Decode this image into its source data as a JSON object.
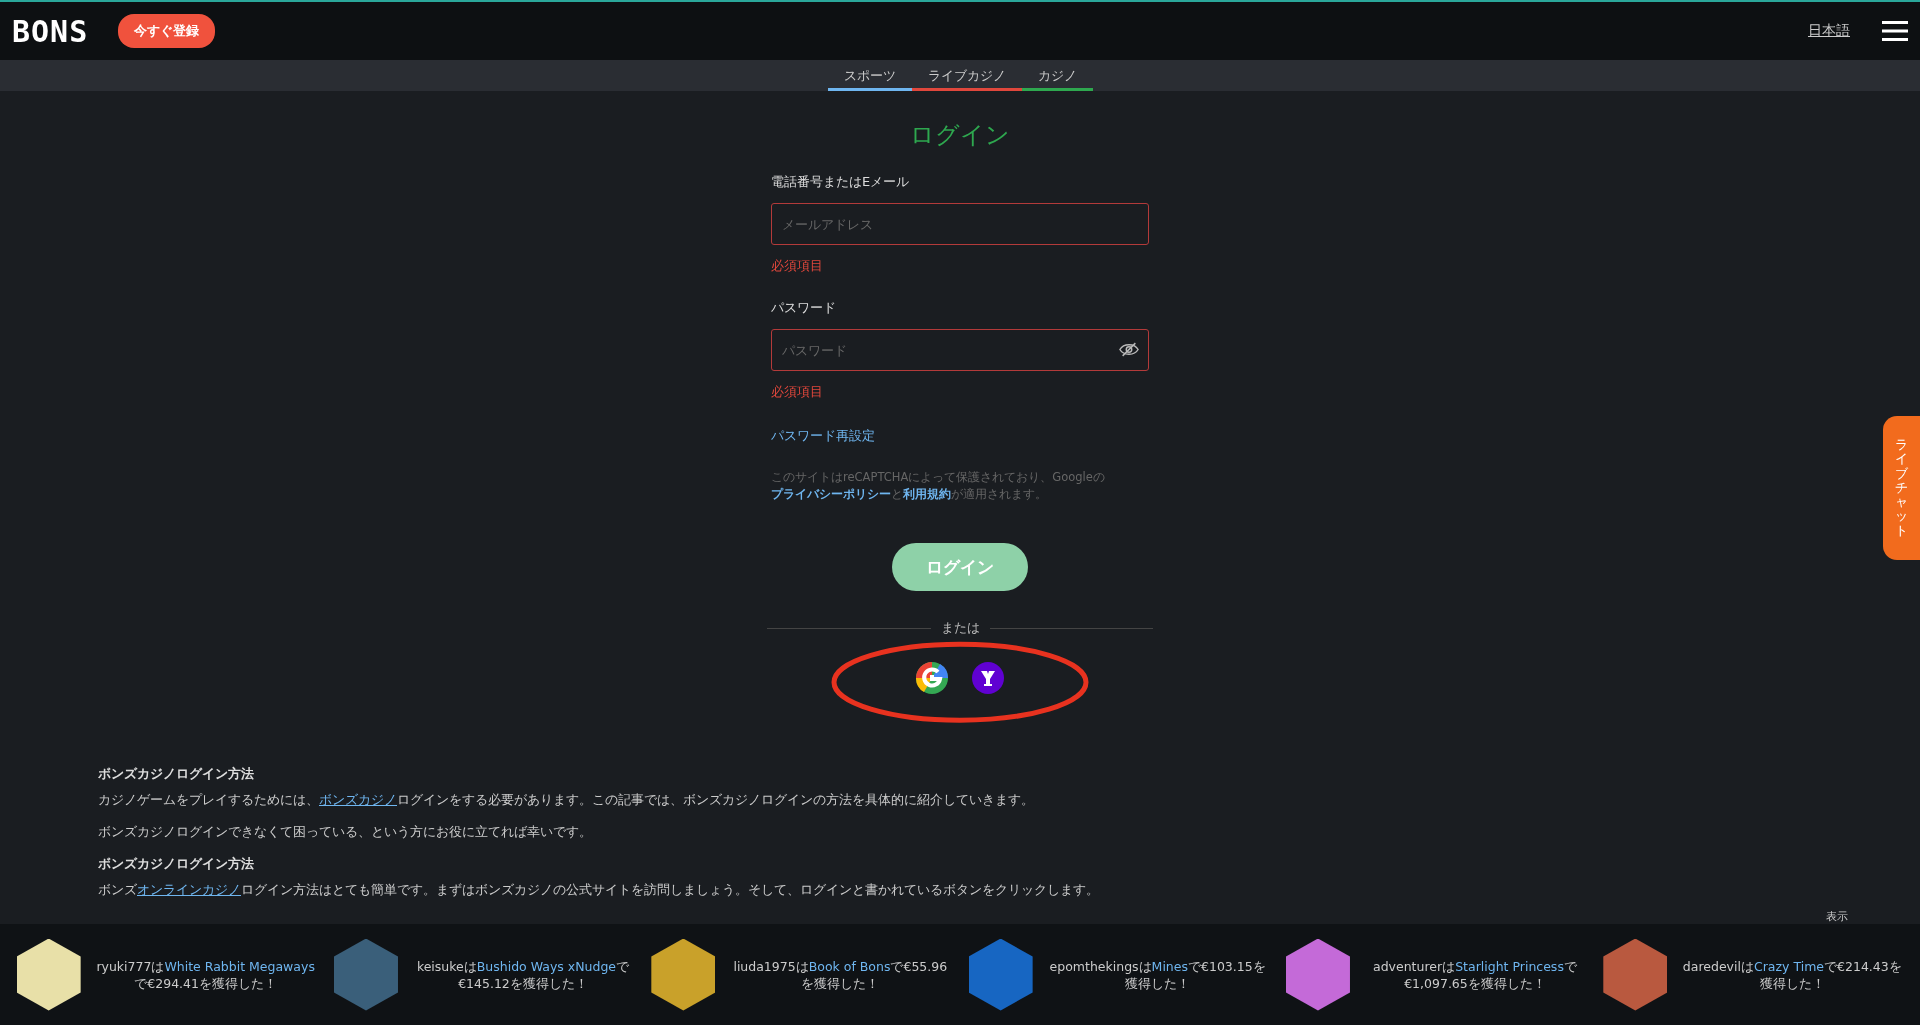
{
  "header": {
    "logo": "BONS",
    "signup_button": "今すぐ登録",
    "language": "日本語"
  },
  "nav_tabs": [
    {
      "label": "スポーツ",
      "color": "#6fb6f0"
    },
    {
      "label": "ライブカジノ",
      "color": "#e0473c"
    },
    {
      "label": "カジノ",
      "color": "#2ea84f"
    }
  ],
  "login": {
    "title": "ログイン",
    "fields": [
      {
        "label": "電話番号またはEメール",
        "placeholder": "メールアドレス",
        "error": "必須項目",
        "kind": "text"
      },
      {
        "label": "パスワード",
        "placeholder": "パスワード",
        "error": "必須項目",
        "kind": "password"
      }
    ],
    "reset_link": "パスワード再設定",
    "recaptcha_note": [
      {
        "text": "このサイトはreCAPTCHAによって保護されており、Googleの",
        "link": false
      },
      {
        "text": "プライバシーポリシー",
        "link": true
      },
      {
        "text": "と",
        "link": false
      },
      {
        "text": "利用規約",
        "link": true
      },
      {
        "text": "が適用されます。",
        "link": false
      }
    ],
    "submit_button": "ログイン",
    "divider": "または",
    "social": [
      {
        "kind": "google"
      },
      {
        "kind": "yahoo"
      }
    ]
  },
  "article": [
    {
      "kind": "heading",
      "parts": [
        {
          "text": "ボンズカジノログイン方法",
          "link": false
        }
      ]
    },
    {
      "kind": "paragraph",
      "parts": [
        {
          "text": "カジノゲームをプレイするためには、",
          "link": false
        },
        {
          "text": "ボンズカジノ",
          "link": true
        },
        {
          "text": "ログインをする必要があります。この記事では、ボンズカジノログインの方法を具体的に紹介していきます。",
          "link": false
        }
      ]
    },
    {
      "kind": "paragraph",
      "parts": [
        {
          "text": "ボンズカジノログインできなくて困っている、という方にお役に立てれば幸いです。",
          "link": false
        }
      ]
    },
    {
      "kind": "heading",
      "parts": [
        {
          "text": "ボンズカジノログイン方法",
          "link": false
        }
      ]
    },
    {
      "kind": "paragraph",
      "parts": [
        {
          "text": "ボンズ",
          "link": false
        },
        {
          "text": "オンラインカジノ",
          "link": true
        },
        {
          "text": "ログイン方法はとても簡単です。まずはボンズカジノの公式サイトを訪問しましょう。そして、ログインと書かれているボタンをクリックします。",
          "link": false
        }
      ]
    }
  ],
  "show_label": "表示",
  "winners": [
    {
      "player": "ryuki777は",
      "game": "White Rabbit Megaways",
      "prize": "で€294.41を獲得した！",
      "color": "#e8e0a8"
    },
    {
      "player": "keisukeは",
      "game": "Bushido Ways xNudge",
      "prize": "で€145.12を獲得した！",
      "color": "#3a5f7a"
    },
    {
      "player": "liuda1975は",
      "game": "Book of Bons",
      "prize": "で€55.96を獲得した！",
      "color": "#c9a12a"
    },
    {
      "player": "epomthekingsは",
      "game": "Mines",
      "prize": "で€103.15を獲得した！",
      "color": "#1766c2"
    },
    {
      "player": "adventurerは",
      "game": "Starlight Princess",
      "prize": "で€1,097.65を獲得した！",
      "color": "#c46ad8"
    },
    {
      "player": "daredevilは",
      "game": "Crazy Time",
      "prize": "で€214.43を獲得した！",
      "color": "#b9593f"
    }
  ],
  "live_chat_tab": "ライブチャット"
}
